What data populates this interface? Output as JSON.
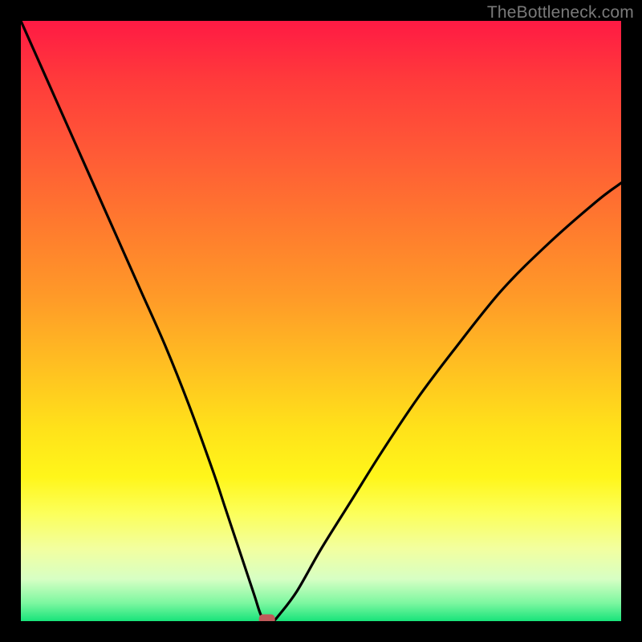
{
  "watermark": "TheBottleneck.com",
  "colors": {
    "background": "#000000",
    "curve": "#000000",
    "marker_fill": "#c05a5a",
    "gradient_top": "#ff1a44",
    "gradient_bottom": "#18e37a"
  },
  "chart_data": {
    "type": "line",
    "title": "",
    "xlabel": "",
    "ylabel": "",
    "xlim": [
      0,
      100
    ],
    "ylim": [
      0,
      100
    ],
    "legend": false,
    "grid": false,
    "series": [
      {
        "name": "bottleneck-curve",
        "x": [
          0,
          4,
          8,
          12,
          16,
          20,
          24,
          28,
          32,
          34,
          36,
          38,
          39,
          40,
          41,
          42,
          43,
          46,
          50,
          55,
          60,
          66,
          72,
          80,
          88,
          96,
          100
        ],
        "values": [
          100,
          91,
          82,
          73,
          64,
          55,
          46,
          36,
          25,
          19,
          13,
          7,
          4,
          1,
          0,
          0,
          1,
          5,
          12,
          20,
          28,
          37,
          45,
          55,
          63,
          70,
          73
        ]
      }
    ],
    "marker": {
      "x": 41,
      "y": 0,
      "shape": "rounded-rect"
    },
    "annotations": []
  }
}
